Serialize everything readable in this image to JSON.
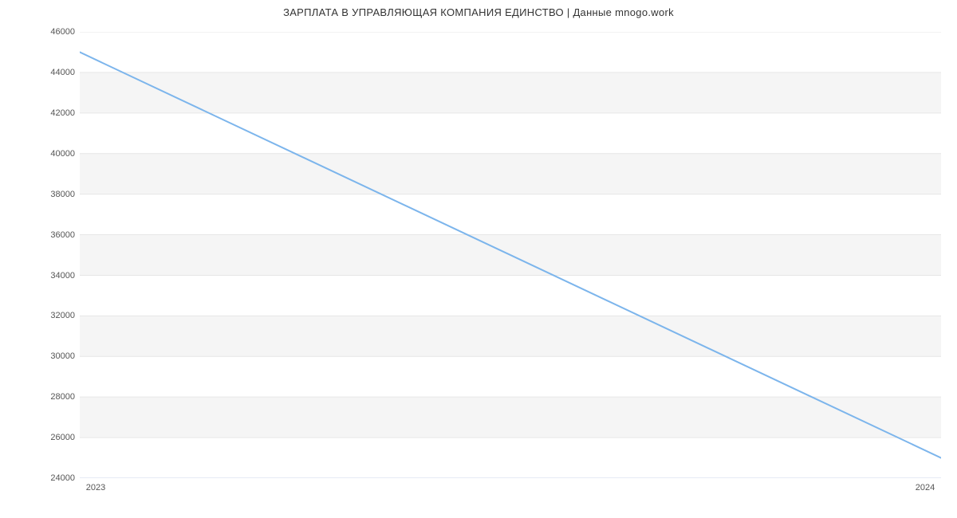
{
  "chart_data": {
    "type": "line",
    "title": "ЗАРПЛАТА В УПРАВЛЯЮЩАЯ КОМПАНИЯ ЕДИНСТВО | Данные mnogo.work",
    "xlabel": "",
    "ylabel": "",
    "x_ticks": [
      "2023",
      "2024"
    ],
    "y_ticks": [
      24000,
      26000,
      28000,
      30000,
      32000,
      34000,
      36000,
      38000,
      40000,
      42000,
      44000,
      46000
    ],
    "ylim": [
      24000,
      46000
    ],
    "x": [
      "2023",
      "2024"
    ],
    "values": [
      45000,
      25000
    ],
    "line_color": "#7cb5ec",
    "grid_band_color": "#f5f5f5"
  }
}
